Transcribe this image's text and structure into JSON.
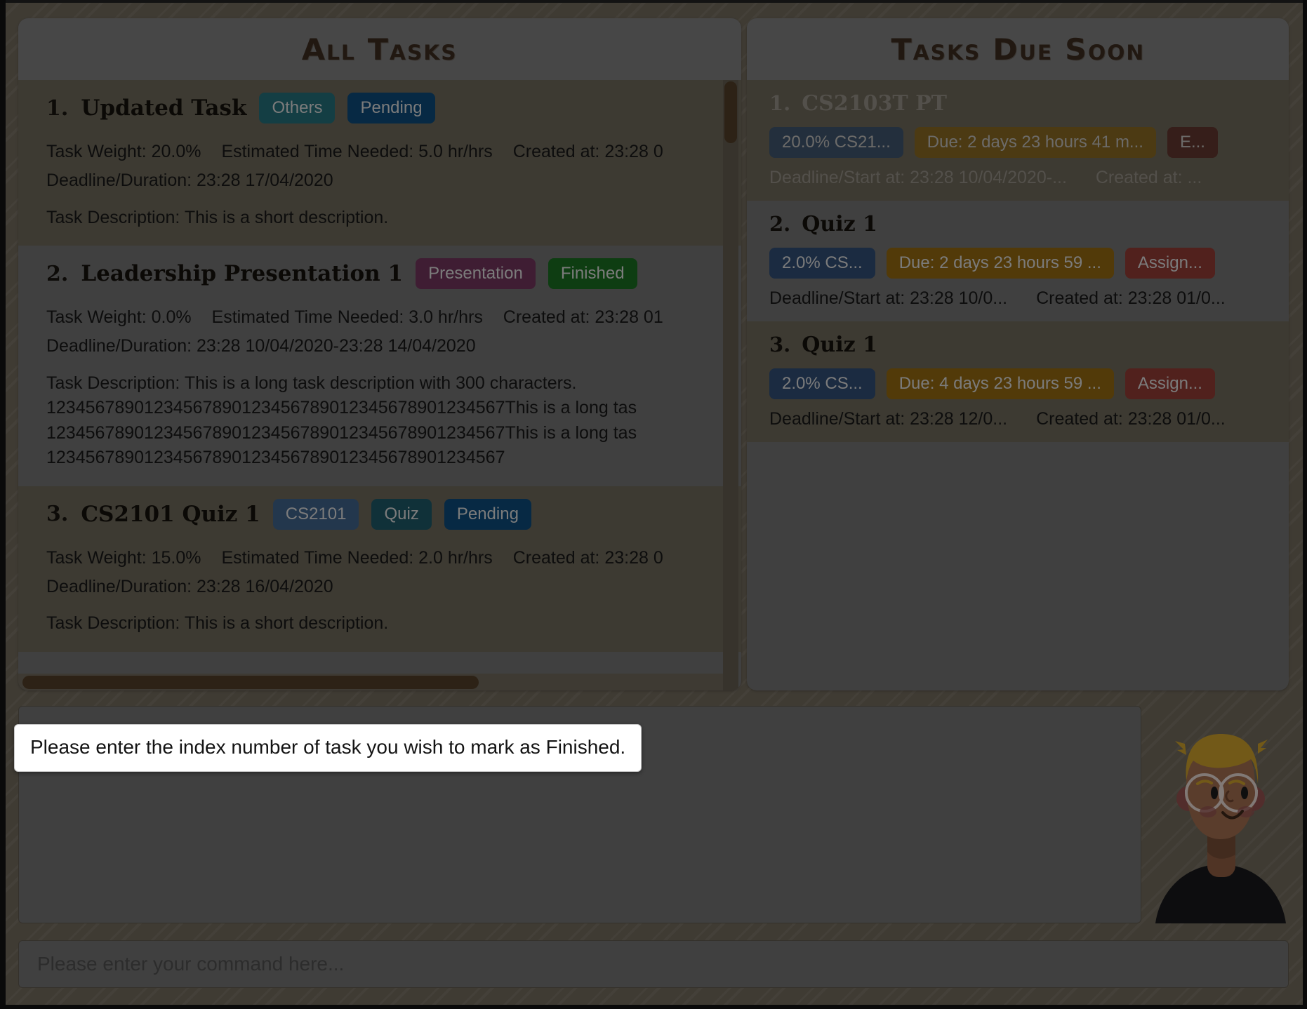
{
  "panels": {
    "all_tasks": {
      "title": "All Tasks",
      "tasks": [
        {
          "index": "1.",
          "name": "Updated Task",
          "chips": [
            {
              "label": "Others",
              "kind": "others"
            },
            {
              "label": "Pending",
              "kind": "pending"
            }
          ],
          "weight": "Task Weight: 20.0%",
          "estimate": "Estimated Time Needed: 5.0 hr/hrs",
          "created": "Created at: 23:28 0",
          "deadline": "Deadline/Duration: 23:28 17/04/2020",
          "description": "Task Description: This is a short description."
        },
        {
          "index": "2.",
          "name": "Leadership Presentation 1",
          "chips": [
            {
              "label": "Presentation",
              "kind": "presentation"
            },
            {
              "label": "Finished",
              "kind": "finished"
            }
          ],
          "weight": "Task Weight: 0.0%",
          "estimate": "Estimated Time Needed: 3.0 hr/hrs",
          "created": "Created at: 23:28 01",
          "deadline": "Deadline/Duration: 23:28 10/04/2020-23:28 14/04/2020",
          "description": "Task Description: This is a long task description with 300 characters.\n12345678901234567890123456789012345678901234567This is a long tas\n12345678901234567890123456789012345678901234567This is a long tas\n12345678901234567890123456789012345678901234567"
        },
        {
          "index": "3.",
          "name": "CS2101 Quiz 1",
          "chips": [
            {
              "label": "CS2101",
              "kind": "module"
            },
            {
              "label": "Quiz",
              "kind": "quiz"
            },
            {
              "label": "Pending",
              "kind": "pending"
            }
          ],
          "weight": "Task Weight: 15.0%",
          "estimate": "Estimated Time Needed: 2.0 hr/hrs",
          "created": "Created at: 23:28 0",
          "deadline": "Deadline/Duration: 23:28 16/04/2020",
          "description": "Task Description: This is a short description."
        }
      ]
    },
    "due_soon": {
      "title": "Tasks Due Soon",
      "tasks": [
        {
          "index": "1.",
          "name": "CS2103T PT",
          "chips": [
            {
              "label": "20.0% CS21...",
              "kind": "weight"
            },
            {
              "label": "Due: 2 days 23 hours 41 m...",
              "kind": "due"
            },
            {
              "label": "E...",
              "kind": "type-dark"
            }
          ],
          "deadline": "Deadline/Start at: 23:28 10/04/2020-...",
          "created": "Created at: ..."
        },
        {
          "index": "2.",
          "name": "Quiz 1",
          "chips": [
            {
              "label": "2.0% CS...",
              "kind": "weight"
            },
            {
              "label": "Due: 2 days 23 hours 59 ...",
              "kind": "due"
            },
            {
              "label": "Assign...",
              "kind": "type"
            }
          ],
          "deadline": "Deadline/Start at: 23:28 10/0...",
          "created": "Created at: 23:28 01/0..."
        },
        {
          "index": "3.",
          "name": "Quiz 1",
          "chips": [
            {
              "label": "2.0% CS...",
              "kind": "weight"
            },
            {
              "label": "Due: 4 days 23 hours 59 ...",
              "kind": "due"
            },
            {
              "label": "Assign...",
              "kind": "type"
            }
          ],
          "deadline": "Deadline/Start at: 23:28 12/0...",
          "created": "Created at: 23:28 01/0..."
        }
      ]
    }
  },
  "modal": {
    "message": "Please enter the index number of task you wish to mark as Finished."
  },
  "command_bar": {
    "placeholder": "Please enter your command here...",
    "value": ""
  },
  "response_box": {
    "value": ""
  },
  "avatar": {
    "name": "user-avatar",
    "hair_color": "#c49a2a",
    "skin_color": "#9c6a4d",
    "shirt_color": "#17171a"
  },
  "colors": {
    "app_background": "#6d6659",
    "panel_background": "#6f6f6f",
    "panel_header": "#7a7a7a",
    "title_text": "#3a2a1e",
    "card_alt": "#6a6456",
    "scrollbar_thumb": "#4e3c26",
    "chip_module": "#3d5f86",
    "chip_others": "#236b75",
    "chip_pending": "#0d4875",
    "chip_presentation": "#6d3358",
    "chip_finished": "#19691f",
    "chip_quiz": "#1c5563",
    "chip_weight": "#2f4b70",
    "chip_due": "#8d6411",
    "chip_type": "#8c3a33"
  }
}
